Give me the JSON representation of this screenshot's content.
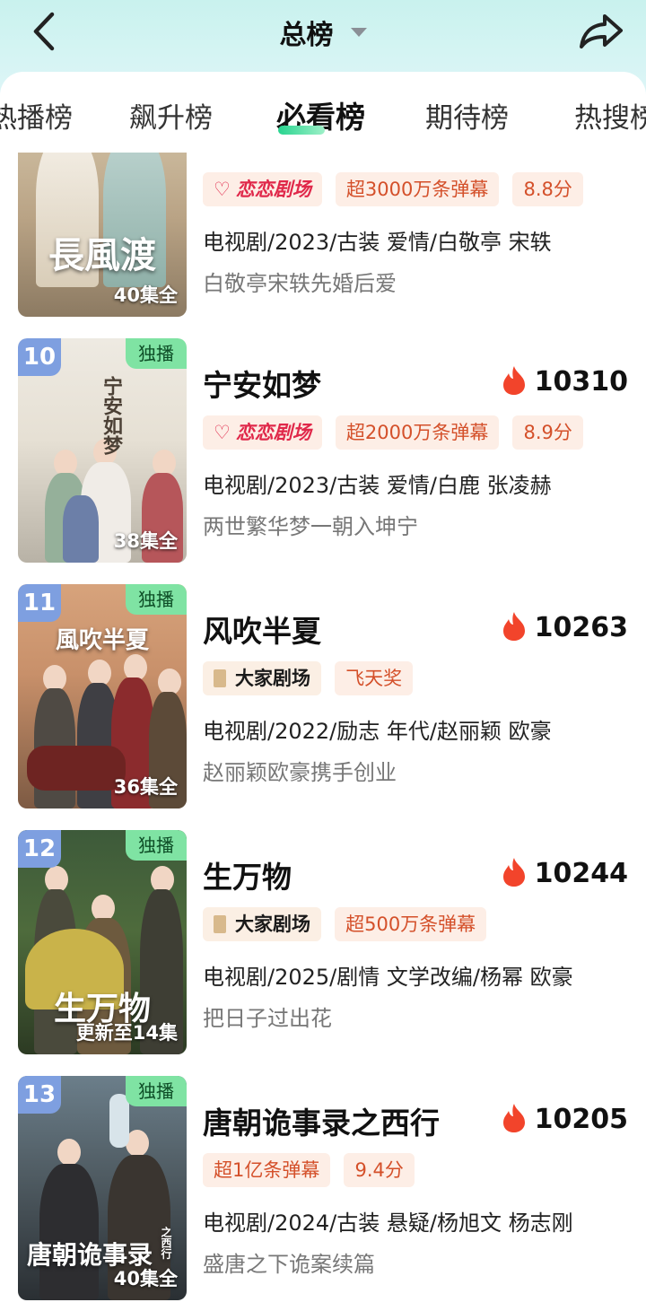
{
  "header": {
    "title": "总榜",
    "icons": {
      "back": "chevron-left-icon",
      "share": "share-arrow-icon",
      "dropdown": "caret-down-icon"
    }
  },
  "tabs": [
    {
      "label": "热播榜",
      "active": false
    },
    {
      "label": "飙升榜",
      "active": false
    },
    {
      "label": "必看榜",
      "active": true
    },
    {
      "label": "期待榜",
      "active": false
    },
    {
      "label": "热搜榜",
      "active": false
    }
  ],
  "colors": {
    "accent_green": "#28d48f",
    "tag_bg": "#fdeee6",
    "tag_text": "#d4502a",
    "rank_badge": "#7e9fe0",
    "exclusive_badge": "#7fe3a3"
  },
  "items": [
    {
      "poster_title": "長風渡",
      "episodes": "40集全",
      "tags": [
        {
          "label": "恋恋剧场",
          "kind": "logo-love"
        },
        {
          "label": "超3000万条弹幕",
          "kind": "plain"
        },
        {
          "label": "8.8分",
          "kind": "plain"
        }
      ],
      "meta": "电视剧/2023/古装 爱情/白敬亭 宋轶",
      "desc": "白敬亭宋轶先婚后爱"
    },
    {
      "rank": "10",
      "exclusive": "独播",
      "poster_title": "宁安如梦",
      "episodes": "38集全",
      "name": "宁安如梦",
      "heat": "10310",
      "tags": [
        {
          "label": "恋恋剧场",
          "kind": "logo-love"
        },
        {
          "label": "超2000万条弹幕",
          "kind": "plain"
        },
        {
          "label": "8.9分",
          "kind": "plain"
        }
      ],
      "meta": "电视剧/2023/古装 爱情/白鹿 张凌赫",
      "desc": "两世繁华梦一朝入坤宁"
    },
    {
      "rank": "11",
      "exclusive": "独播",
      "poster_title": "風吹半夏",
      "episodes": "36集全",
      "name": "风吹半夏",
      "heat": "10263",
      "tags": [
        {
          "label": "大家剧场",
          "kind": "logo-dajia"
        },
        {
          "label": "飞天奖",
          "kind": "plain"
        }
      ],
      "meta": "电视剧/2022/励志 年代/赵丽颖 欧豪",
      "desc": "赵丽颖欧豪携手创业"
    },
    {
      "rank": "12",
      "exclusive": "独播",
      "poster_title": "生万物",
      "episodes": "更新至14集",
      "name": "生万物",
      "heat": "10244",
      "tags": [
        {
          "label": "大家剧场",
          "kind": "logo-dajia"
        },
        {
          "label": "超500万条弹幕",
          "kind": "plain"
        }
      ],
      "meta": "电视剧/2025/剧情 文学改编/杨幂 欧豪",
      "desc": "把日子过出花"
    },
    {
      "rank": "13",
      "exclusive": "独播",
      "poster_title": "唐朝诡事录",
      "poster_subtitle": "之西行",
      "episodes": "40集全",
      "name": "唐朝诡事录之西行",
      "heat": "10205",
      "tags": [
        {
          "label": "超1亿条弹幕",
          "kind": "plain"
        },
        {
          "label": "9.4分",
          "kind": "plain"
        }
      ],
      "meta": "电视剧/2024/古装 悬疑/杨旭文 杨志刚",
      "desc": "盛唐之下诡案续篇"
    }
  ]
}
